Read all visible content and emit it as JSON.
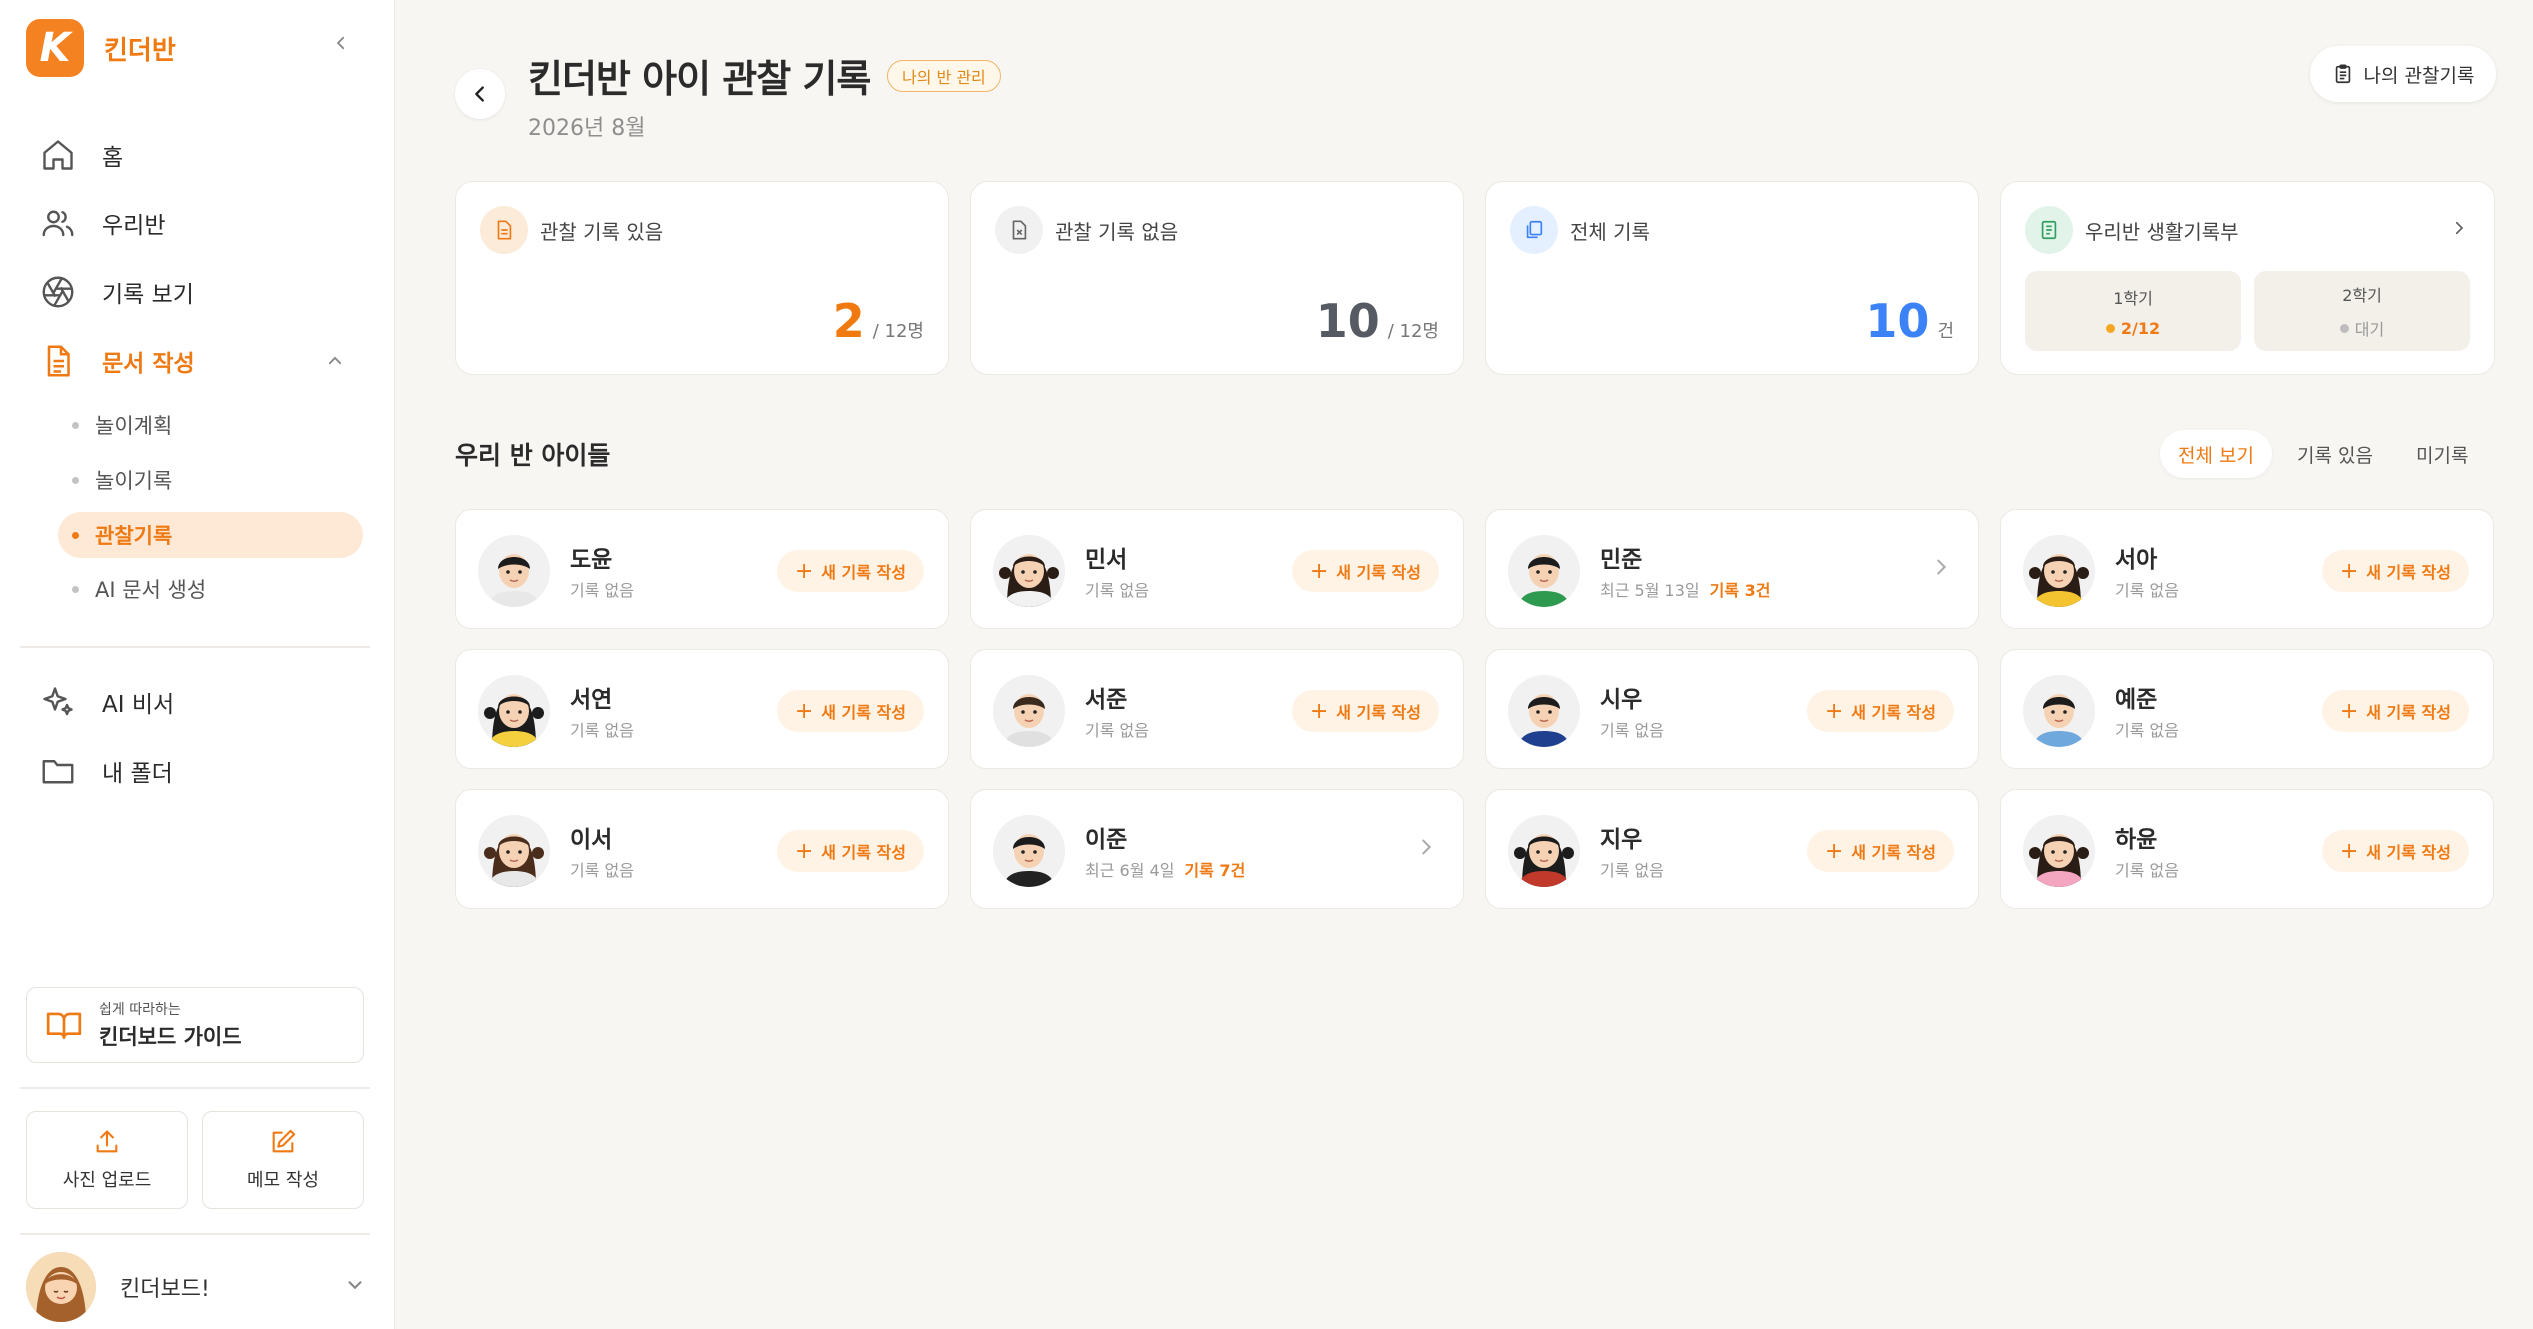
{
  "brand": {
    "name": "킨더반"
  },
  "sidebar": {
    "nav": [
      {
        "label": "홈",
        "icon": "home-icon"
      },
      {
        "label": "우리반",
        "icon": "users-icon"
      },
      {
        "label": "기록 보기",
        "icon": "aperture-icon"
      },
      {
        "label": "문서 작성",
        "icon": "document-icon"
      }
    ],
    "sub": [
      "놀이계획",
      "놀이기록",
      "관찰기록",
      "AI 문서 생성"
    ],
    "extra": [
      {
        "label": "AI 비서",
        "icon": "sparkle-icon"
      },
      {
        "label": "내 폴더",
        "icon": "folder-icon"
      }
    ],
    "guide": {
      "small": "쉽게 따라하는",
      "big": "킨더보드 가이드"
    },
    "quick": [
      {
        "label": "사진 업로드"
      },
      {
        "label": "메모 작성"
      }
    ],
    "user": {
      "name": "킨더보드!"
    }
  },
  "header": {
    "title": "킨더반 아이 관찰 기록",
    "badge": "나의 반 관리",
    "subtitle": "2026년 8월",
    "my_button": "나의 관찰기록"
  },
  "stats": [
    {
      "label": "관찰 기록 있음",
      "value": "2",
      "unit": "/ 12명",
      "color": "#f07a10"
    },
    {
      "label": "관찰 기록 없음",
      "value": "10",
      "unit": "/ 12명",
      "color": "#555a63"
    },
    {
      "label": "전체 기록",
      "value": "10",
      "unit": "건",
      "color": "#3b82f6"
    }
  ],
  "record_book": {
    "label": "우리반 생활기록부",
    "semesters": [
      {
        "name": "1학기",
        "value": "2/12",
        "color": "#f5a623"
      },
      {
        "name": "2학기",
        "value": "대기",
        "color": "#bdbdbd"
      }
    ]
  },
  "children_section": {
    "title": "우리 반 아이들",
    "filters": [
      "전체 보기",
      "기록 있음",
      "미기록"
    ],
    "new_label": "새 기록 작성",
    "children": [
      {
        "name": "도윤",
        "status": "기록 없음",
        "count": ""
      },
      {
        "name": "민서",
        "status": "기록 없음",
        "count": ""
      },
      {
        "name": "민준",
        "status": "최근 5월 13일",
        "count": "기록 3건"
      },
      {
        "name": "서아",
        "status": "기록 없음",
        "count": ""
      },
      {
        "name": "서연",
        "status": "기록 없음",
        "count": ""
      },
      {
        "name": "서준",
        "status": "기록 없음",
        "count": ""
      },
      {
        "name": "시우",
        "status": "기록 없음",
        "count": ""
      },
      {
        "name": "예준",
        "status": "기록 없음",
        "count": ""
      },
      {
        "name": "이서",
        "status": "기록 없음",
        "count": ""
      },
      {
        "name": "이준",
        "status": "최근 6월 4일",
        "count": "기록 7건"
      },
      {
        "name": "지우",
        "status": "기록 없음",
        "count": ""
      },
      {
        "name": "하윤",
        "status": "기록 없음",
        "count": ""
      }
    ]
  }
}
